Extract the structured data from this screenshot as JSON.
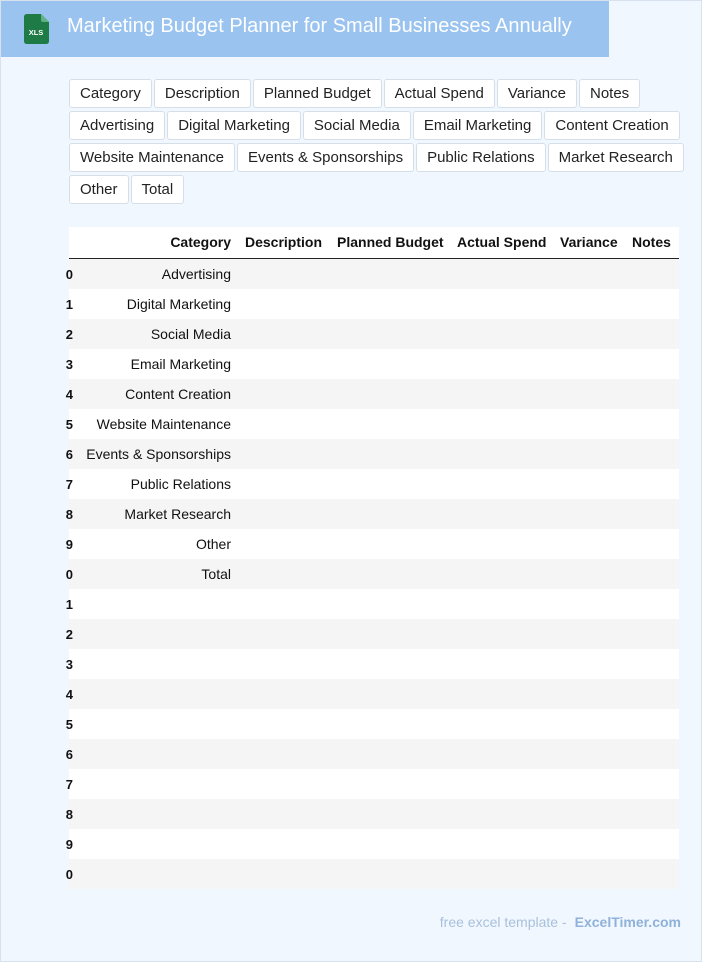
{
  "header": {
    "title": "Marketing Budget Planner for Small Businesses Annually",
    "icon": "xls-file-icon",
    "icon_label": "XLS",
    "background": "#9ac4ef"
  },
  "chips": [
    "Category",
    "Description",
    "Planned Budget",
    "Actual Spend",
    "Variance",
    "Notes",
    "Advertising",
    "Digital Marketing",
    "Social Media",
    "Email Marketing",
    "Content Creation",
    "Website Maintenance",
    "Events & Sponsorships",
    "Public Relations",
    "Market Research",
    "Other",
    "Total"
  ],
  "table": {
    "columns": [
      "Category",
      "Description",
      "Planned Budget",
      "Actual Spend",
      "Variance",
      "Notes"
    ],
    "rows": [
      {
        "idx": "0",
        "category": "Advertising"
      },
      {
        "idx": "1",
        "category": "Digital Marketing"
      },
      {
        "idx": "2",
        "category": "Social Media"
      },
      {
        "idx": "3",
        "category": "Email Marketing"
      },
      {
        "idx": "4",
        "category": "Content Creation"
      },
      {
        "idx": "5",
        "category": "Website Maintenance"
      },
      {
        "idx": "6",
        "category": "Events & Sponsorships"
      },
      {
        "idx": "7",
        "category": "Public Relations"
      },
      {
        "idx": "8",
        "category": "Market Research"
      },
      {
        "idx": "9",
        "category": "Other"
      },
      {
        "idx": "0",
        "category": "Total"
      },
      {
        "idx": "1",
        "category": ""
      },
      {
        "idx": "2",
        "category": ""
      },
      {
        "idx": "3",
        "category": ""
      },
      {
        "idx": "4",
        "category": ""
      },
      {
        "idx": "5",
        "category": ""
      },
      {
        "idx": "6",
        "category": ""
      },
      {
        "idx": "7",
        "category": ""
      },
      {
        "idx": "8",
        "category": ""
      },
      {
        "idx": "9",
        "category": ""
      },
      {
        "idx": "0",
        "category": ""
      }
    ]
  },
  "footer": {
    "text": "free excel template -",
    "brand": "ExcelTimer.com"
  }
}
